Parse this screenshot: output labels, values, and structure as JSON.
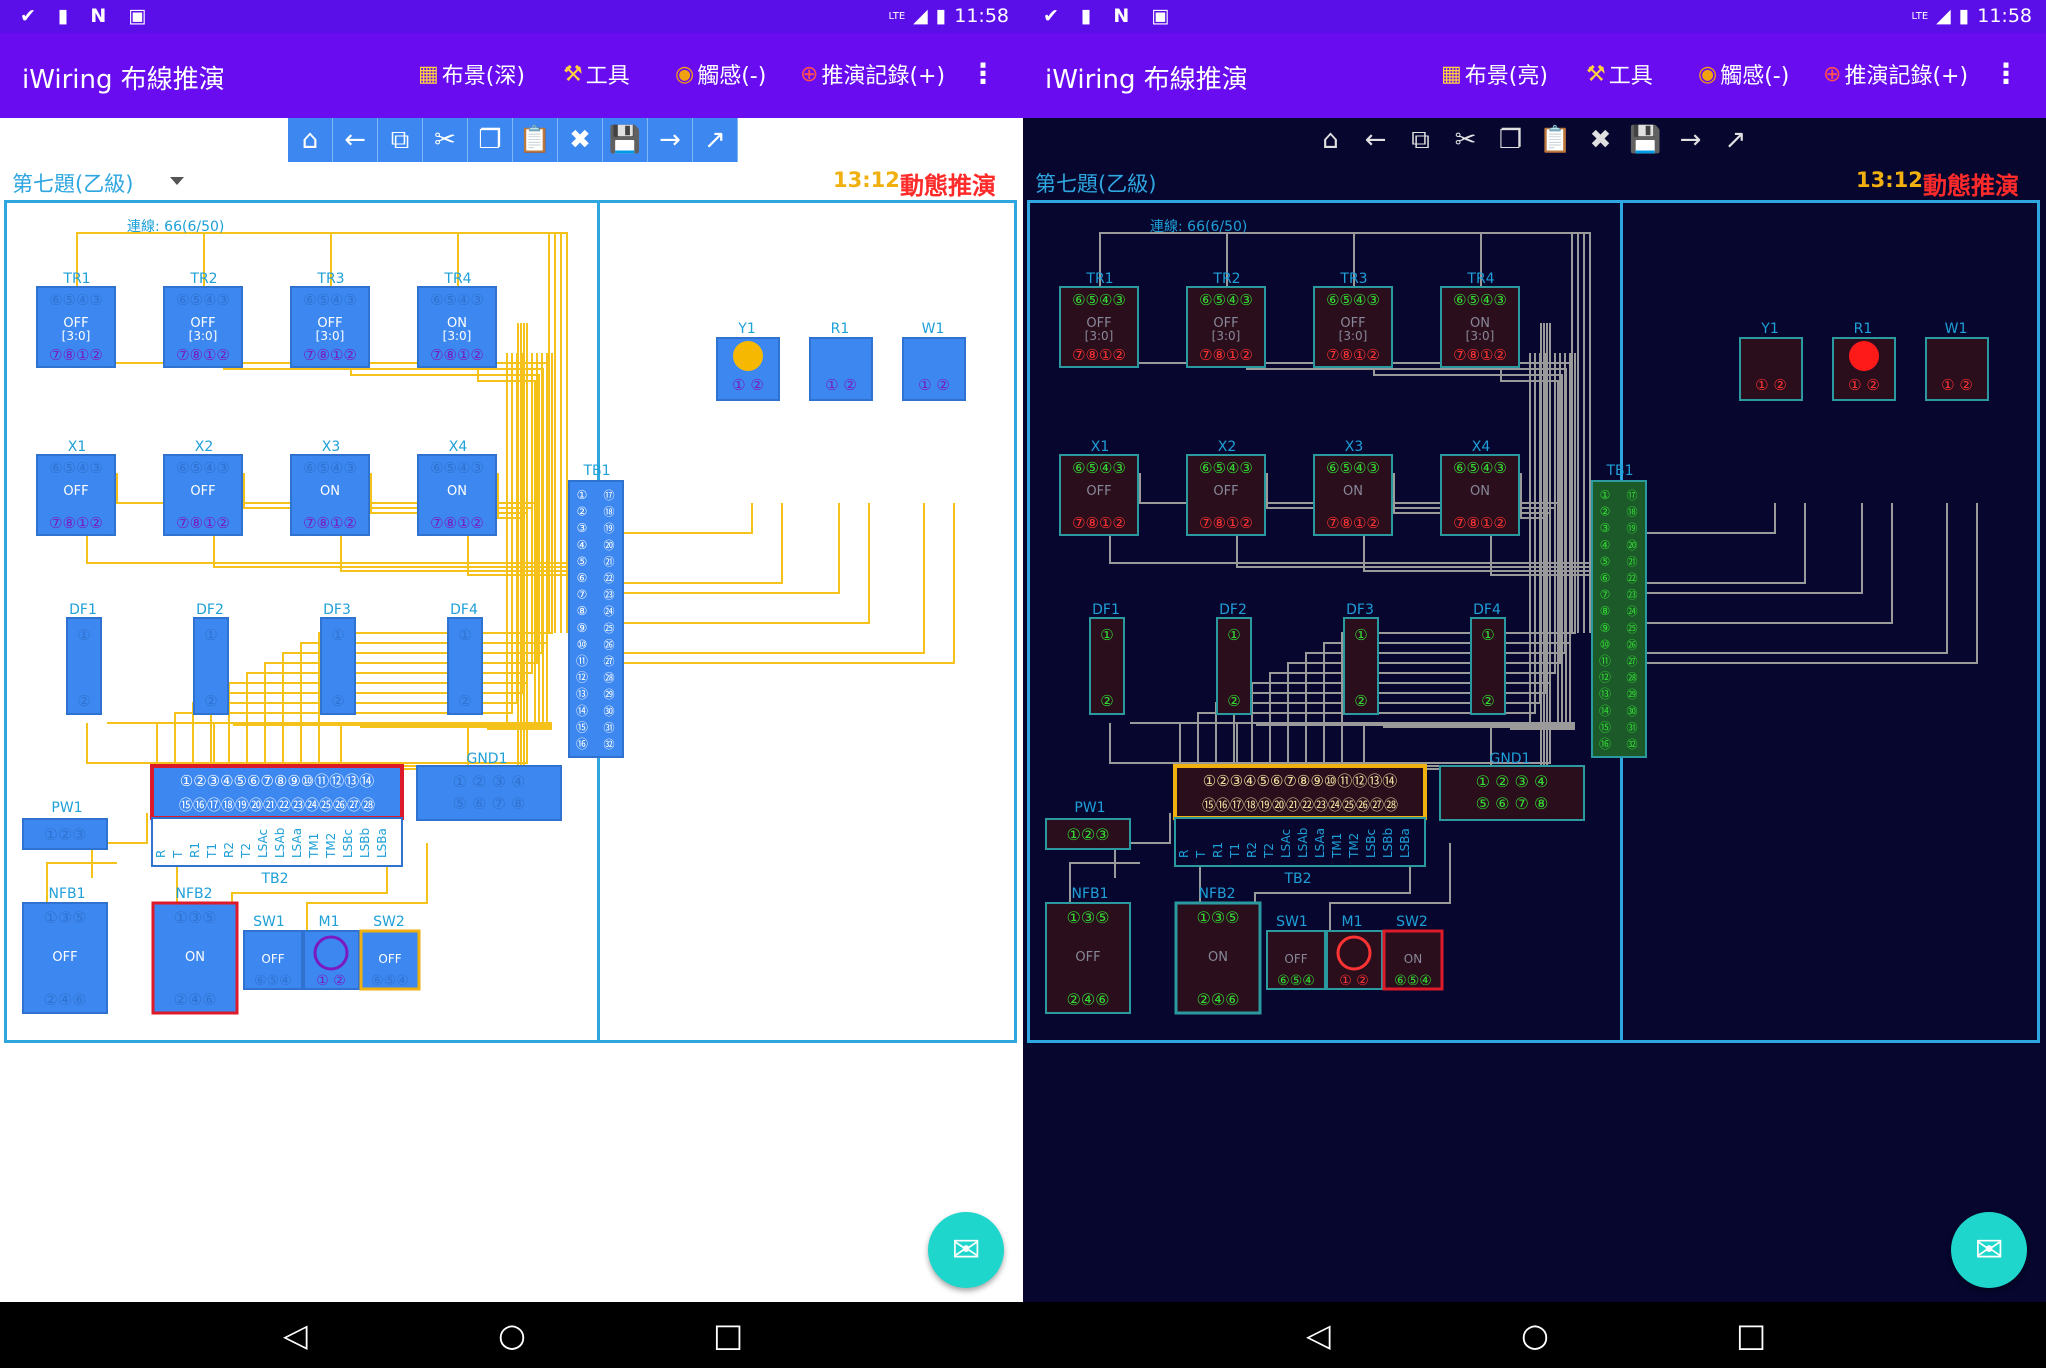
{
  "panes": [
    {
      "theme": "light",
      "status": {
        "clock": "11:58",
        "net": "LTE"
      },
      "app": {
        "title": "iWiring 布線推演",
        "menu": {
          "layout": "布景(深)",
          "tools": "工具",
          "touch": "觸感(-)",
          "record": "推演記錄(+)"
        }
      },
      "subtitle": "第七題(乙級)",
      "timer": "13:12",
      "mode": "動態推演",
      "diagram": {
        "connection": "連線: 66(6/50)"
      }
    },
    {
      "theme": "dark",
      "status": {
        "clock": "11:58",
        "net": "LTE"
      },
      "app": {
        "title": "iWiring 布線推演",
        "menu": {
          "layout": "布景(亮)",
          "tools": "工具",
          "touch": "觸感(-)",
          "record": "推演記錄(+)"
        }
      },
      "subtitle": "第七題(乙級)",
      "timer": "13:12",
      "mode": "動態推演",
      "diagram": {
        "connection": "連線: 66(6/50)"
      }
    }
  ],
  "toolbar_icons": [
    "home-icon",
    "back-arrow-icon",
    "copy-icon",
    "cut-icon",
    "duplicate-icon",
    "clipboard-icon",
    "delete-icon",
    "save-icon",
    "forward-arrow-icon",
    "expand-icon"
  ],
  "relays": [
    {
      "name": "TR1",
      "top": "⑥⑤④③",
      "state": "OFF",
      "sub": "[3:0]",
      "bottom": "⑦⑧①②"
    },
    {
      "name": "TR2",
      "top": "⑥⑤④③",
      "state": "OFF",
      "sub": "[3:0]",
      "bottom": "⑦⑧①②"
    },
    {
      "name": "TR3",
      "top": "⑥⑤④③",
      "state": "OFF",
      "sub": "[3:0]",
      "bottom": "⑦⑧①②"
    },
    {
      "name": "TR4",
      "top": "⑥⑤④③",
      "state": "ON",
      "sub": "[3:0]",
      "bottom": "⑦⑧①②"
    },
    {
      "name": "X1",
      "top": "⑥⑤④③",
      "state": "OFF",
      "sub": "",
      "bottom": "⑦⑧①②"
    },
    {
      "name": "X2",
      "top": "⑥⑤④③",
      "state": "OFF",
      "sub": "",
      "bottom": "⑦⑧①②"
    },
    {
      "name": "X3",
      "top": "⑥⑤④③",
      "state": "ON",
      "sub": "",
      "bottom": "⑦⑧①②"
    },
    {
      "name": "X4",
      "top": "⑥⑤④③",
      "state": "ON",
      "sub": "",
      "bottom": "⑦⑧①②"
    }
  ],
  "lamps": [
    {
      "name": "Y1",
      "pins": "① ②",
      "lit_light": true,
      "lit_dark": false
    },
    {
      "name": "R1",
      "pins": "① ②",
      "lit_light": false,
      "lit_dark": true
    },
    {
      "name": "W1",
      "pins": "① ②",
      "lit_light": false,
      "lit_dark": false
    }
  ],
  "dfs": [
    {
      "name": "DF1",
      "top": "①",
      "bottom": "②"
    },
    {
      "name": "DF2",
      "top": "①",
      "bottom": "②"
    },
    {
      "name": "DF3",
      "top": "①",
      "bottom": "②"
    },
    {
      "name": "DF4",
      "top": "①",
      "bottom": "②"
    }
  ],
  "tb1": {
    "name": "TB1",
    "left": [
      "①",
      "②",
      "③",
      "④",
      "⑤",
      "⑥",
      "⑦",
      "⑧",
      "⑨",
      "⑩",
      "⑪",
      "⑫",
      "⑬",
      "⑭",
      "⑮",
      "⑯"
    ],
    "right": [
      "⑰",
      "⑱",
      "⑲",
      "⑳",
      "㉑",
      "㉒",
      "㉓",
      "㉔",
      "㉕",
      "㉖",
      "㉗",
      "㉘",
      "㉙",
      "㉚",
      "㉛",
      "㉜"
    ]
  },
  "tb2": {
    "name": "TB2",
    "row1": "①②③④⑤⑥⑦⑧⑨⑩⑪⑫⑬⑭",
    "row2": "⑮⑯⑰⑱⑲⑳㉑㉒㉓㉔㉕㉖㉗㉘",
    "labels": [
      "R",
      "T",
      "R1",
      "T1",
      "R2",
      "T2",
      "LSAc",
      "LSAb",
      "LSAa",
      "TM1",
      "TM2",
      "LSBc",
      "LSBb",
      "LSBa"
    ]
  },
  "gnd1": {
    "name": "GND1",
    "row1": "① ② ③ ④",
    "row2": "⑤ ⑥ ⑦ ⑧"
  },
  "pw1": {
    "name": "PW1",
    "pins": "①②③"
  },
  "nfb1": {
    "name": "NFB1",
    "top": "①③⑤",
    "state": "OFF",
    "bottom": "②④⑥"
  },
  "nfb2": {
    "name": "NFB2",
    "top": "①③⑤",
    "state": "ON",
    "bottom": "②④⑥"
  },
  "sw1": {
    "name": "SW1",
    "state": "OFF",
    "pins": "⑥⑤④"
  },
  "m1": {
    "name": "M1",
    "pins": "① ②"
  },
  "sw2": {
    "name": "SW2",
    "state_light": "OFF",
    "state_dark": "ON",
    "pins": "⑥⑤④"
  },
  "colors": {
    "appbar": "#6a0cf0",
    "component_light": "#3d88f0",
    "component_dark": "#2a0e1c",
    "wire_light": "#f4c21a",
    "wire_dark": "#9a9a9a",
    "frame": "#2ea6e0",
    "fab": "#1fd6cc",
    "alert": "#ff2a2a"
  }
}
